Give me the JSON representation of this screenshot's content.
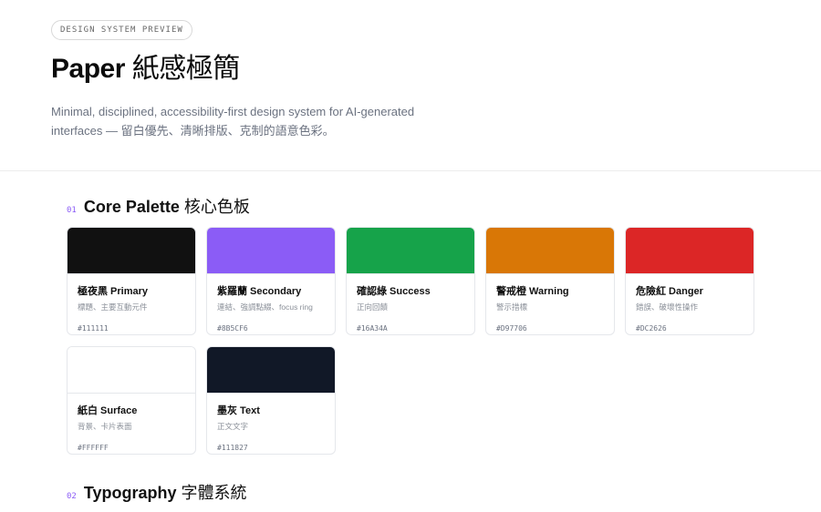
{
  "hero": {
    "badge": "DESIGN SYSTEM PREVIEW",
    "title_en": "Paper",
    "title_cjk": "紙感極簡",
    "subtitle_line1": "Minimal, disciplined, accessibility-first design system for AI-generated",
    "subtitle_line2": "interfaces — 留白優先、清晰排版、克制的語意色彩。"
  },
  "sections": [
    {
      "num": "01",
      "title_en": "Core Palette",
      "title_cjk": "核心色板"
    },
    {
      "num": "02",
      "title_en": "Typography",
      "title_cjk": "字體系統"
    }
  ],
  "palette": [
    {
      "name": "極夜黑 Primary",
      "desc": "標題、主要互動元件",
      "hex": "#111111",
      "color": "#111111"
    },
    {
      "name": "紫羅蘭 Secondary",
      "desc": "連結、強調點綴、focus ring",
      "hex": "#8B5CF6",
      "color": "#8B5CF6"
    },
    {
      "name": "確認綠 Success",
      "desc": "正向回饋",
      "hex": "#16A34A",
      "color": "#16A34A"
    },
    {
      "name": "警戒橙 Warning",
      "desc": "警示措標",
      "hex": "#D97706",
      "color": "#D97706"
    },
    {
      "name": "危險紅 Danger",
      "desc": "錯誤、破壞性操作",
      "hex": "#DC2626",
      "color": "#DC2626"
    },
    {
      "name": "紙白 Surface",
      "desc": "背景、卡片表面",
      "hex": "#FFFFFF",
      "color": "#FFFFFF"
    },
    {
      "name": "墨灰 Text",
      "desc": "正文文字",
      "hex": "#111827",
      "color": "#111827"
    }
  ]
}
